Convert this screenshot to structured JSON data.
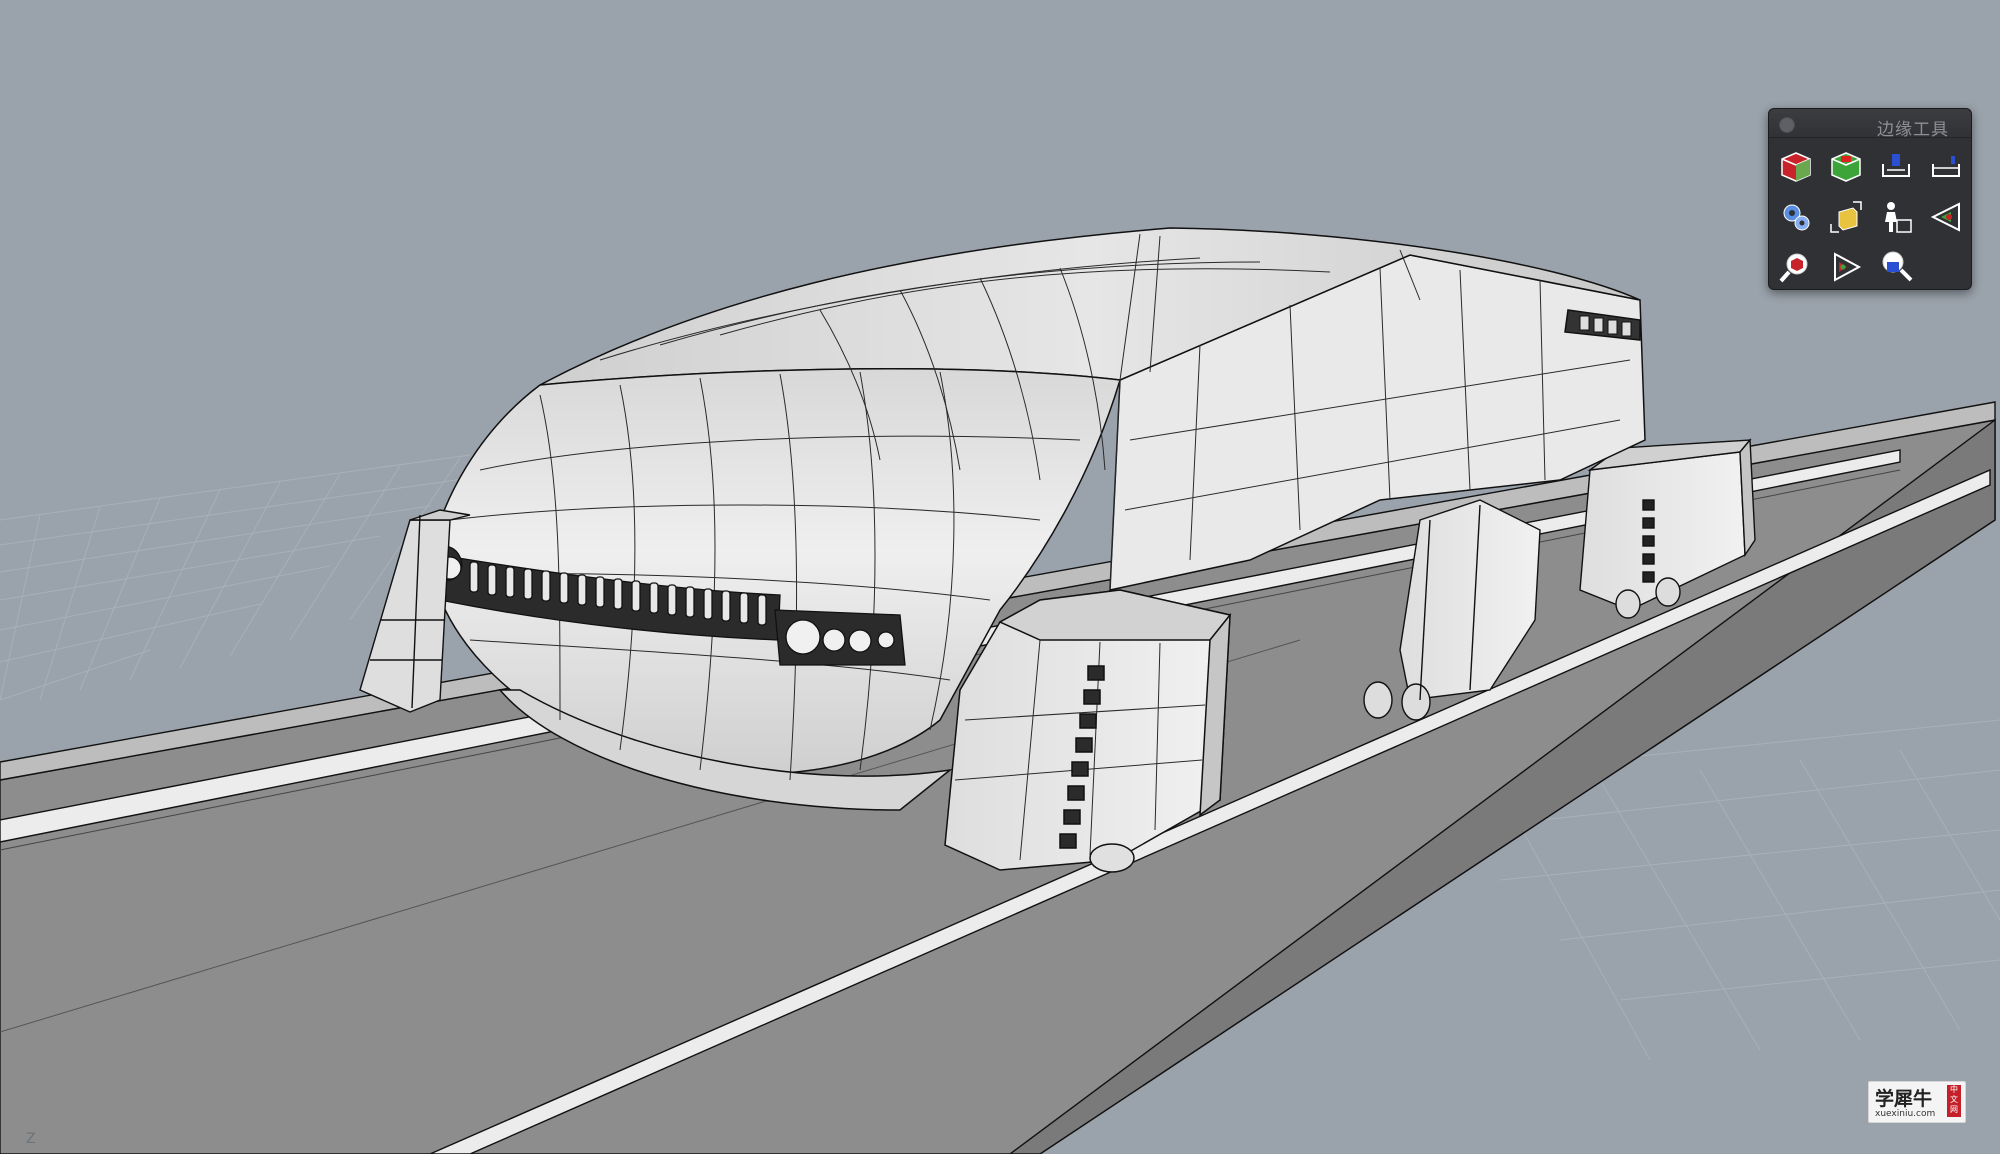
{
  "viewport": {
    "axis_label": "Z"
  },
  "palette": {
    "title": "边缘工具",
    "tools": [
      {
        "icon": "red-cube-icon"
      },
      {
        "icon": "green-cube-icon"
      },
      {
        "icon": "edge-blue-icon"
      },
      {
        "icon": "edge-outline-icon"
      },
      {
        "icon": "puzzle-gear-icon"
      },
      {
        "icon": "yellow-box-scale-icon"
      },
      {
        "icon": "person-desk-icon"
      },
      {
        "icon": "triangle-red-icon"
      },
      {
        "icon": "magnify-red-icon"
      },
      {
        "icon": "triangle-play-icon"
      },
      {
        "icon": "magnify-box-icon"
      }
    ]
  },
  "watermark": {
    "main": "学犀牛",
    "badge": "中文网",
    "url": "xuexiniu.com"
  },
  "colors": {
    "background": "#9aa2ab",
    "palette_bg": "#2f3134",
    "grid_line": "#a6aeb6",
    "model_fill": "#e4e4e4",
    "edge_line": "#111111"
  }
}
